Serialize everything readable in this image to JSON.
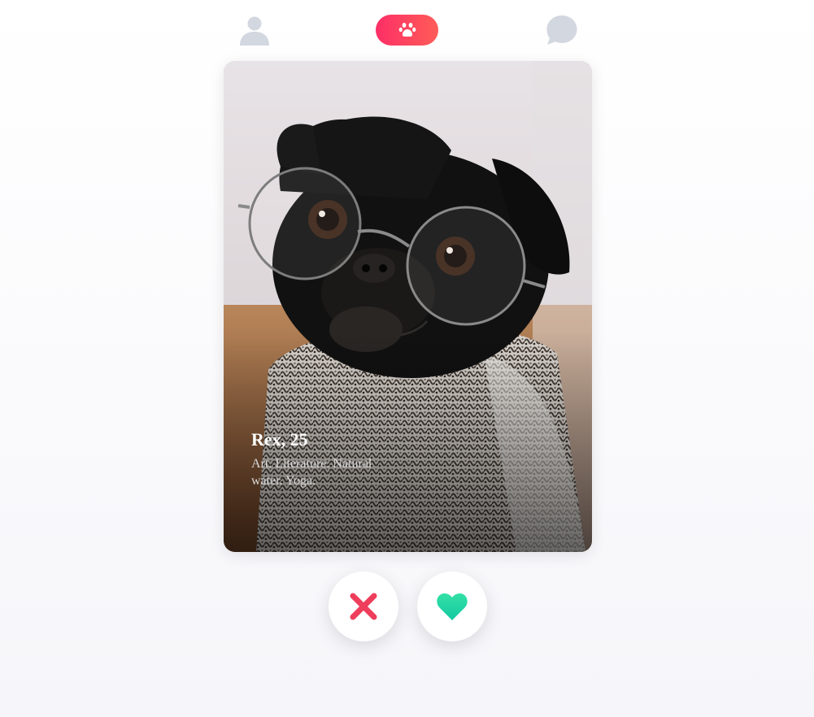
{
  "nav": {
    "profile_icon": "user-icon",
    "home_icon": "paw-icon",
    "messages_icon": "chat-bubble-icon",
    "home_gradient": [
      "#fd2f66",
      "#ff5c58"
    ],
    "inactive_icon_color": "#d3d7e0"
  },
  "profile": {
    "name_age": "Rex, 25",
    "bio": "Art. Literature. Natural water. Yoga."
  },
  "actions": {
    "dislike_icon": "close-icon",
    "like_icon": "heart-icon",
    "dislike_color": "#ee3e5b",
    "like_colors": [
      "#33e0a6",
      "#14c9a1"
    ]
  }
}
